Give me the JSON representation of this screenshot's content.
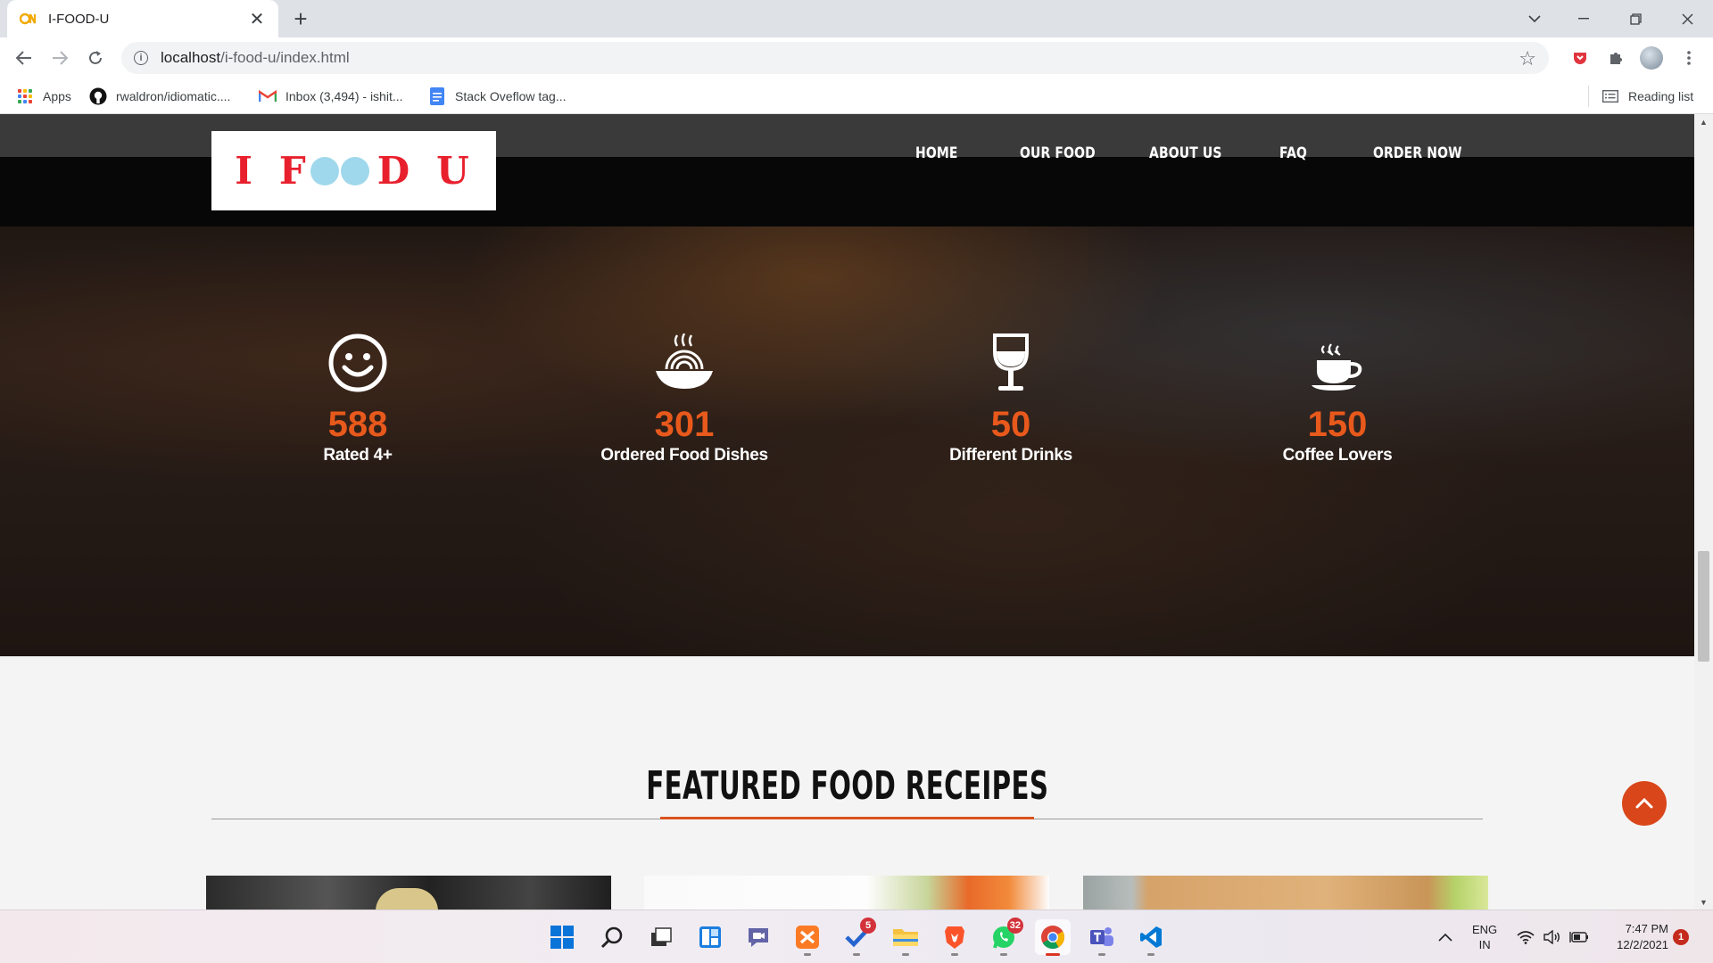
{
  "browser": {
    "tab_title": "I-FOOD-U",
    "url_host": "localhost",
    "url_path": "/i-food-u/index.html",
    "bookmarks": [
      {
        "label": "Apps",
        "icon": "apps-grid-icon"
      },
      {
        "label": "rwaldron/idiomatic....",
        "icon": "github-icon"
      },
      {
        "label": "Inbox (3,494) - ishit...",
        "icon": "gmail-icon"
      },
      {
        "label": "Stack Oveflow tag...",
        "icon": "docs-icon"
      }
    ],
    "reading_list": "Reading list"
  },
  "site": {
    "logo": {
      "letters": [
        "I",
        "F",
        "D",
        "U"
      ]
    },
    "menu": [
      "HOME",
      "OUR FOOD",
      "ABOUT US",
      "FAQ",
      "ORDER NOW"
    ],
    "counters": [
      {
        "value": "588",
        "label": "Rated 4+",
        "icon": "smiley-icon"
      },
      {
        "value": "301",
        "label": "Ordered Food Dishes",
        "icon": "noodle-bowl-icon"
      },
      {
        "value": "50",
        "label": "Different Drinks",
        "icon": "wine-glass-icon"
      },
      {
        "value": "150",
        "label": "Coffee Lovers",
        "icon": "coffee-cup-icon"
      }
    ],
    "featured_title": "FEATURED FOOD RECEIPES",
    "accent_color": "#e8591c"
  },
  "taskbar": {
    "badges": {
      "todo": "5",
      "whatsapp": "32"
    },
    "lang_line1": "ENG",
    "lang_line2": "IN",
    "time": "7:47 PM",
    "date": "12/2/2021",
    "notification_count": "1"
  }
}
